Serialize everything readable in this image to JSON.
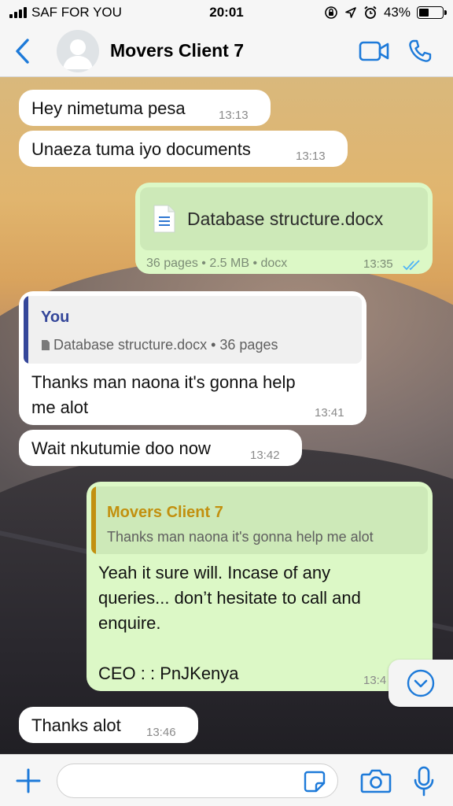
{
  "status_bar": {
    "carrier": "SAF FOR YOU",
    "time": "20:01",
    "battery": "43%",
    "battery_level": 0.43
  },
  "header": {
    "contact_name": "Movers Client 7",
    "back_icon": "chevron-left-icon",
    "video_icon": "video-camera-icon",
    "call_icon": "phone-icon"
  },
  "messages": [
    {
      "direction": "in",
      "text": "Hey nimetuma pesa",
      "time": "13:13"
    },
    {
      "direction": "in",
      "text": "Unaeza tuma iyo documents",
      "time": "13:13"
    },
    {
      "direction": "out",
      "type": "document",
      "file_name": "Database structure.docx",
      "meta": "36 pages • 2.5 MB • docx",
      "time": "13:35",
      "status": "read"
    },
    {
      "direction": "in",
      "reply_to": {
        "author": "You",
        "text": "Database structure.docx • 36 pages"
      },
      "text_line1": "Thanks man naona it's gonna help",
      "text_line2": "me alot",
      "time": "13:41"
    },
    {
      "direction": "in",
      "text": "Wait nkutumie doo now",
      "time": "13:42"
    },
    {
      "direction": "out",
      "reply_to": {
        "author": "Movers Client 7",
        "text": "Thanks man naona it's gonna help me alot"
      },
      "text_line1": "Yeah it sure will. Incase of any",
      "text_line2": "queries... don’t hesitate to call and",
      "text_line3": "enquire.",
      "text_line5": "CEO : : PnJKenya",
      "time": "13:4"
    },
    {
      "direction": "in",
      "text": "Thanks alot",
      "time": "13:46"
    }
  ],
  "input": {
    "value": "",
    "placeholder": ""
  },
  "colors": {
    "accent": "#1d7ad9",
    "outgoing_bubble": "#dcf8c6",
    "incoming_bubble": "#ffffff",
    "read_ticks": "#4fb3f6",
    "quote_bar_you": "#35479a",
    "quote_bar_client": "#c2900f"
  }
}
